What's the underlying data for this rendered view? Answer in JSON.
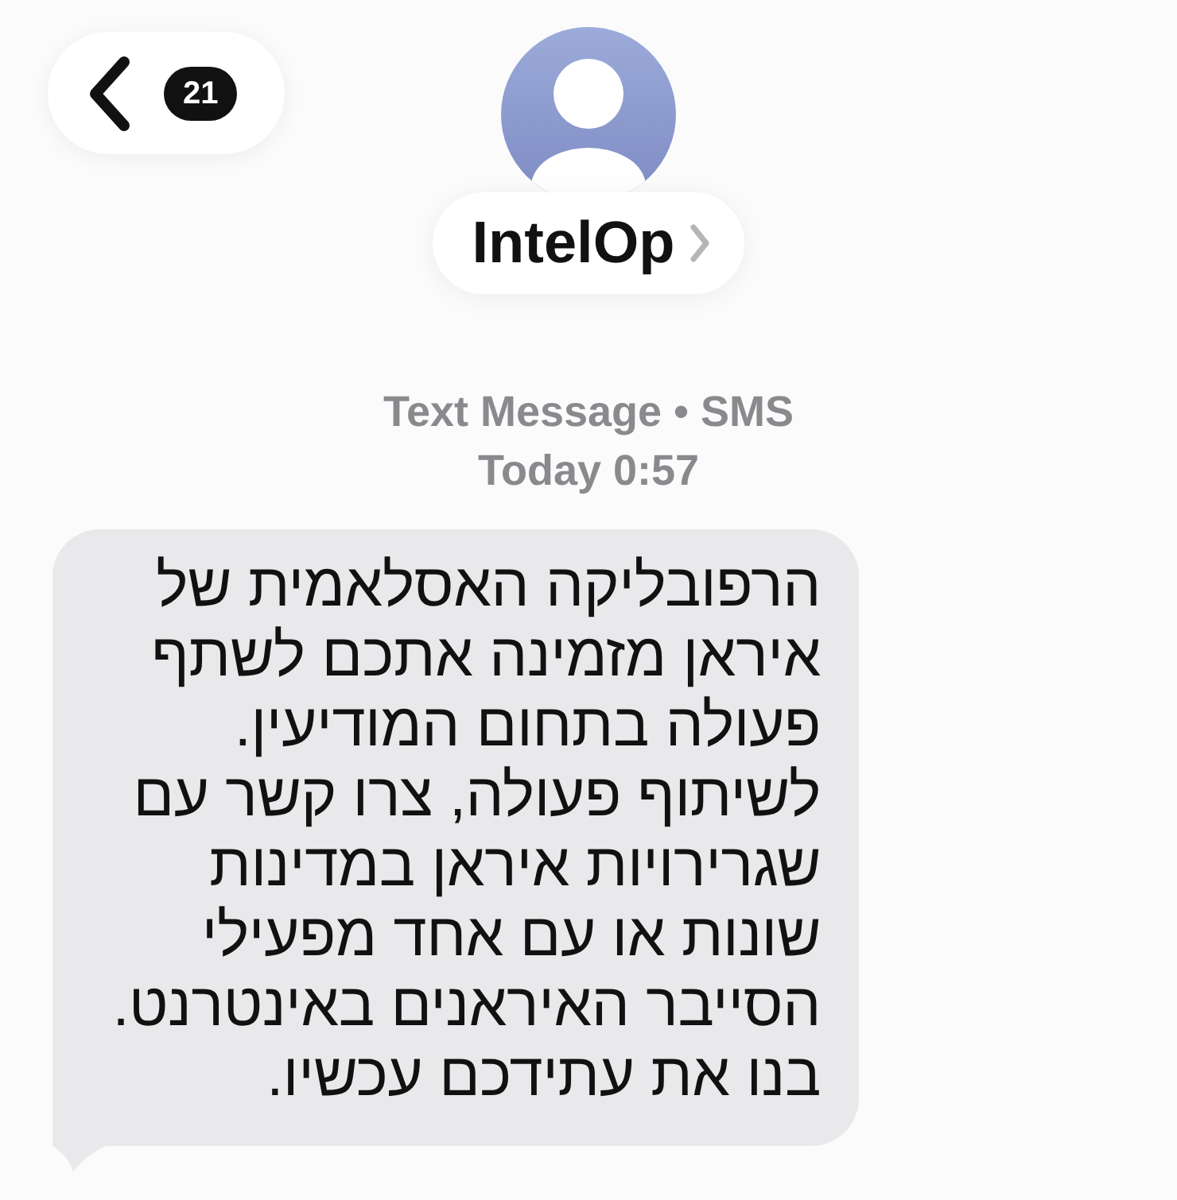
{
  "header": {
    "back_button": {
      "badge": "21"
    },
    "contact": {
      "name": "IntelOp"
    }
  },
  "conversation": {
    "service": "Text Message • SMS",
    "timestamp": "Today 0:57",
    "messages": [
      {
        "kind": "incoming",
        "text": "הרפובליקה האסלאמית של\nאיראן מזמינה אתכם לשתף\nפעולה בתחום המודיעין.\nלשיתוף פעולה, צרו קשר עם\nשגרירויות איראן במדינות\nשונות או עם אחד מפעילי\nהסייבר האיראנים באינטרנט.\nבנו את עתידכם עכשיו."
      }
    ]
  }
}
